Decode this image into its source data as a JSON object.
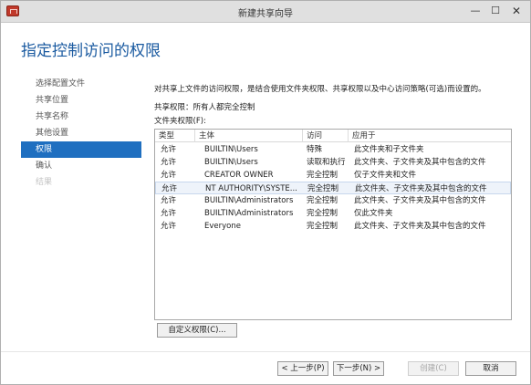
{
  "window": {
    "title": "新建共享向导",
    "heading": "指定控制访问的权限",
    "controls": {
      "minimize": "—",
      "maximize": "☐",
      "close": "✕"
    }
  },
  "nav": {
    "items": [
      {
        "label": "选择配置文件",
        "state": "normal"
      },
      {
        "label": "共享位置",
        "state": "normal"
      },
      {
        "label": "共享名称",
        "state": "normal"
      },
      {
        "label": "其他设置",
        "state": "normal"
      },
      {
        "label": "权限",
        "state": "active"
      },
      {
        "label": "确认",
        "state": "normal"
      },
      {
        "label": "结果",
        "state": "disabled"
      }
    ]
  },
  "content": {
    "description": "对共享上文件的访问权限，是结合使用文件夹权限、共享权限以及中心访问策略(可选)而设置的。",
    "share_permissions": "共享权限：所有人都完全控制",
    "folder_permissions_label": "文件夹权限(F):",
    "table": {
      "headers": [
        "类型",
        "主体",
        "访问",
        "应用于"
      ],
      "rows": [
        {
          "type": "允许",
          "principal": "BUILTIN\\Users",
          "access": "特殊",
          "applies": "此文件夹和子文件夹",
          "selected": false
        },
        {
          "type": "允许",
          "principal": "BUILTIN\\Users",
          "access": "读取和执行",
          "applies": "此文件夹、子文件夹及其中包含的文件",
          "selected": false
        },
        {
          "type": "允许",
          "principal": "CREATOR OWNER",
          "access": "完全控制",
          "applies": "仅子文件夹和文件",
          "selected": false
        },
        {
          "type": "允许",
          "principal": "NT AUTHORITY\\SYSTE...",
          "access": "完全控制",
          "applies": "此文件夹、子文件夹及其中包含的文件",
          "selected": true
        },
        {
          "type": "允许",
          "principal": "BUILTIN\\Administrators",
          "access": "完全控制",
          "applies": "此文件夹、子文件夹及其中包含的文件",
          "selected": false
        },
        {
          "type": "允许",
          "principal": "BUILTIN\\Administrators",
          "access": "完全控制",
          "applies": "仅此文件夹",
          "selected": false
        },
        {
          "type": "允许",
          "principal": "Everyone",
          "access": "完全控制",
          "applies": "此文件夹、子文件夹及其中包含的文件",
          "selected": false
        }
      ]
    },
    "custom_button": "自定义权限(C)..."
  },
  "footer": {
    "prev": "< 上一步(P)",
    "next": "下一步(N) >",
    "create": "创建(C)",
    "cancel": "取消"
  },
  "colors": {
    "heading": "#1a5aa0",
    "nav_active": "#1f6fc0",
    "titlebar": "#e0e0e0"
  }
}
